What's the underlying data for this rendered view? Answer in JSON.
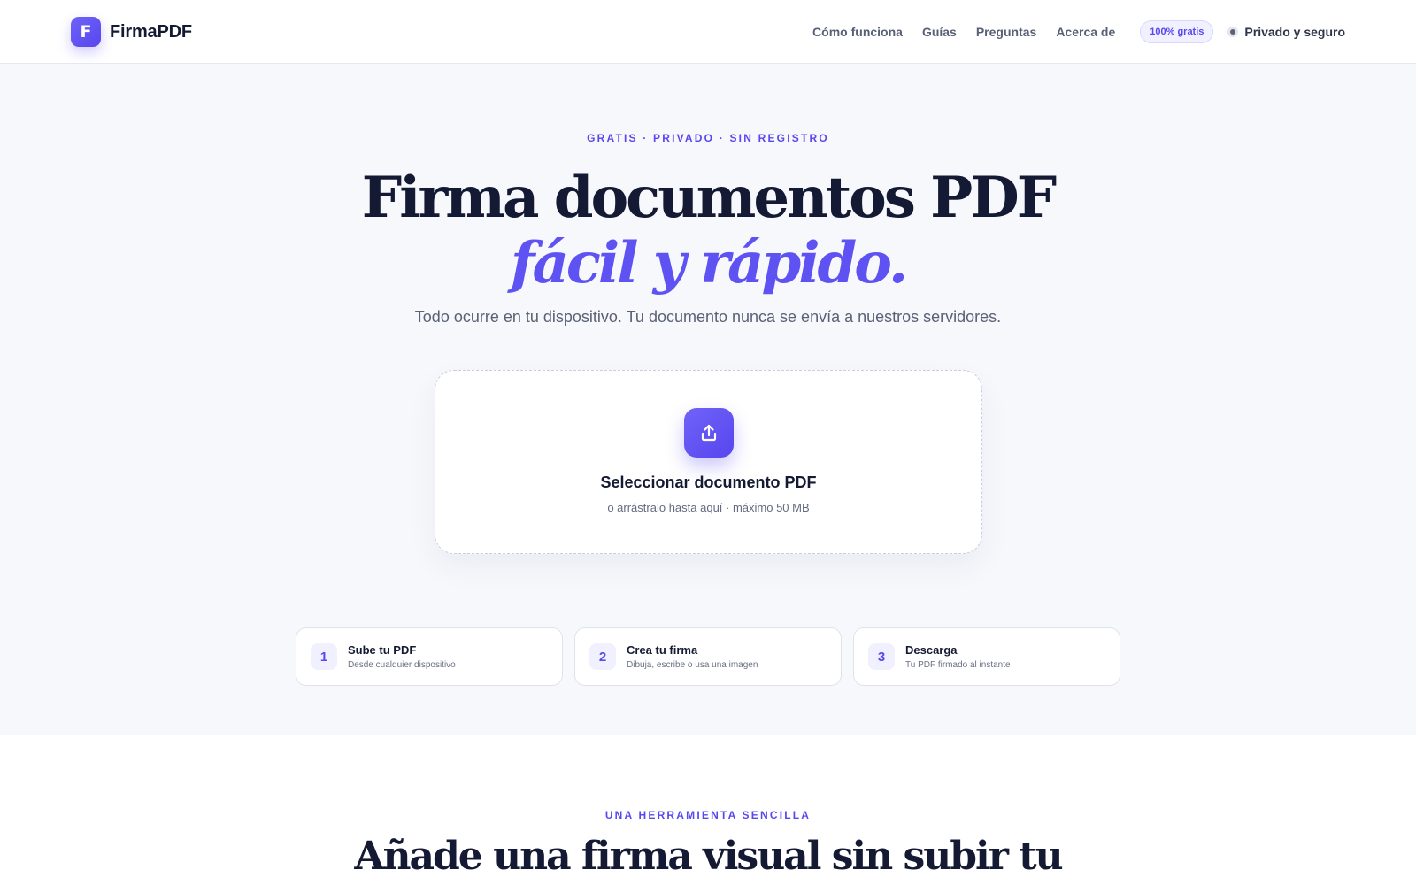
{
  "brand": {
    "logo_letter": "F",
    "name": "FirmaPDF",
    "accent_color": "#5848ee"
  },
  "nav": {
    "links": [
      "Cómo funciona",
      "Guías",
      "Preguntas",
      "Acerca de"
    ],
    "badge": "100% gratis",
    "privacy_label": "Privado y seguro"
  },
  "hero": {
    "eyebrow": "GRATIS · PRIVADO · SIN REGISTRO",
    "title": "Firma documentos PDF",
    "title_accent": "fácil y rápido.",
    "subtitle": "Todo ocurre en tu dispositivo. Tu documento nunca se envía a nuestros servidores.",
    "upload": {
      "icon": "upload-icon",
      "title": "Seleccionar documento PDF",
      "subtitle": "o arrástralo hasta aquí · máximo 50 MB"
    },
    "steps": [
      {
        "number": "1",
        "title": "Sube tu PDF",
        "subtitle": "Desde cualquier dispositivo"
      },
      {
        "number": "2",
        "title": "Crea tu firma",
        "subtitle": "Dibuja, escribe o usa una imagen"
      },
      {
        "number": "3",
        "title": "Descarga",
        "subtitle": "Tu PDF firmado al instante"
      }
    ]
  },
  "section": {
    "eyebrow": "UNA HERRAMIENTA SENCILLA",
    "title": "Añade una firma visual sin subir tu"
  }
}
